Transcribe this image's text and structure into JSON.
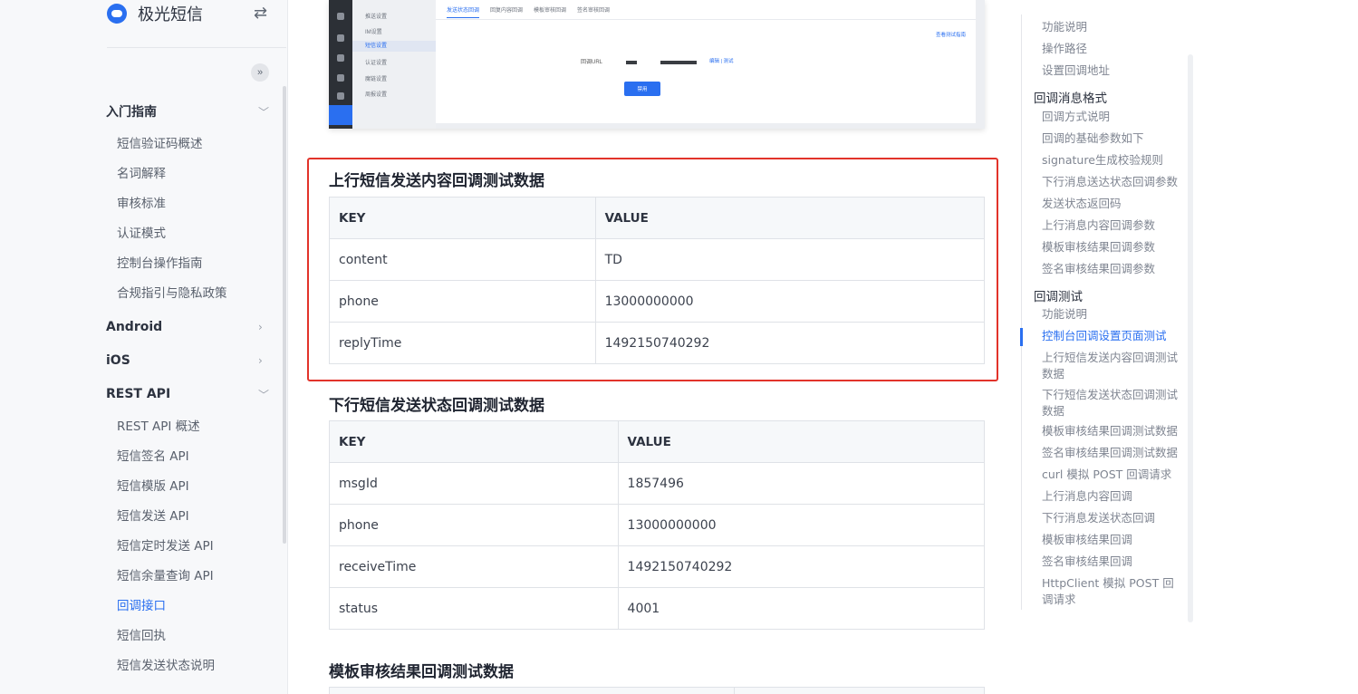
{
  "brand": {
    "name": "极光短信"
  },
  "sidebar": {
    "groups": [
      {
        "label": "入门指南",
        "items": [
          "短信验证码概述",
          "名词解释",
          "审核标准",
          "认证模式",
          "控制台操作指南",
          "合规指引与隐私政策"
        ]
      },
      {
        "label": "Android"
      },
      {
        "label": "iOS"
      },
      {
        "label": "REST API",
        "items": [
          "REST API 概述",
          "短信签名 API",
          "短信模版 API",
          "短信发送 API",
          "短信定时发送 API",
          "短信余量查询 API",
          "回调接口",
          "短信回执",
          "短信发送状态说明"
        ]
      }
    ],
    "active_item": "回调接口"
  },
  "screenshot": {
    "menu": [
      "推送设置",
      "IM设置",
      "短信设置",
      "认证设置",
      "魔链设置",
      "周报设置"
    ],
    "tabs": [
      "发送状态回调",
      "回复内容回调",
      "模板审核回调",
      "签名审核回调"
    ],
    "help_link": "查看测试指南",
    "url_label": "回调URL",
    "edit_link": "编辑 | 测试",
    "button": "禁用"
  },
  "sections": [
    {
      "title": "上行短信发送内容回调测试数据",
      "headers": [
        "KEY",
        "VALUE"
      ],
      "rows": [
        [
          "content",
          "TD"
        ],
        [
          "phone",
          "13000000000"
        ],
        [
          "replyTime",
          "1492150740292"
        ]
      ]
    },
    {
      "title": "下行短信发送状态回调测试数据",
      "headers": [
        "KEY",
        "VALUE"
      ],
      "rows": [
        [
          "msgId",
          "1857496"
        ],
        [
          "phone",
          "13000000000"
        ],
        [
          "receiveTime",
          "1492150740292"
        ],
        [
          "status",
          "4001"
        ]
      ]
    },
    {
      "title": "模板审核结果回调测试数据"
    }
  ],
  "toc": {
    "top_items": [
      "功能说明",
      "操作路径",
      "设置回调地址"
    ],
    "sections": [
      {
        "label": "回调消息格式",
        "items": [
          "回调方式说明",
          "回调的基础参数如下",
          "signature生成校验规则",
          "下行消息送达状态回调参数",
          "发送状态返回码",
          "上行消息内容回调参数",
          "模板审核结果回调参数",
          "签名审核结果回调参数"
        ]
      },
      {
        "label": "回调测试",
        "items": [
          "功能说明",
          "控制台回调设置页面测试",
          "上行短信发送内容回调测试数据",
          "下行短信发送状态回调测试数据",
          "模板审核结果回调测试数据",
          "签名审核结果回调测试数据",
          "curl 模拟 POST 回调请求",
          "上行消息内容回调",
          "下行消息发送状态回调",
          "模板审核结果回调",
          "签名审核结果回调",
          "HttpClient 模拟 POST 回调请求"
        ]
      }
    ],
    "active_item": "控制台回调设置页面测试"
  },
  "colors": {
    "accent": "#2a6ff0",
    "highlight_border": "#e2332a"
  }
}
